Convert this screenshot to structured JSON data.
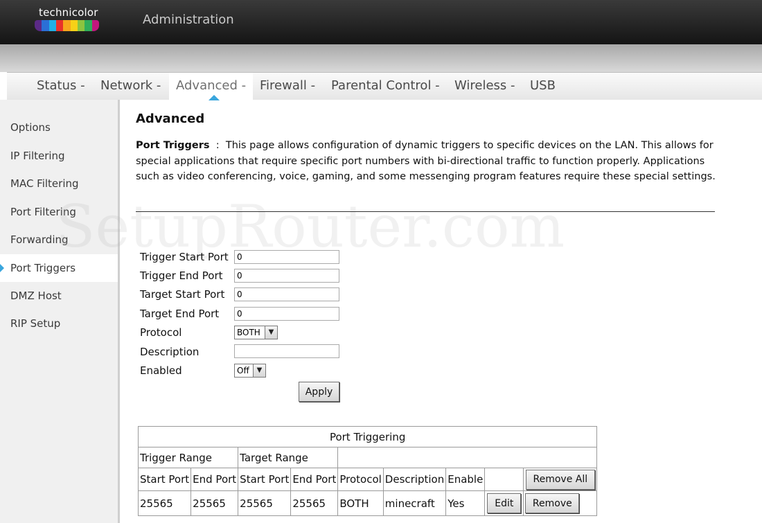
{
  "header": {
    "brand": "technicolor",
    "app_title": "Administration",
    "logo_colors": [
      "#5b2a86",
      "#2b6fd6",
      "#1fb0e6",
      "#e8312a",
      "#f7a51c",
      "#f7d117",
      "#8cc43f",
      "#2fae5b",
      "#c2177d"
    ]
  },
  "nav": {
    "items": [
      {
        "label": "Status -"
      },
      {
        "label": "Network -"
      },
      {
        "label": "Advanced -"
      },
      {
        "label": "Firewall -"
      },
      {
        "label": "Parental Control -"
      },
      {
        "label": "Wireless -"
      },
      {
        "label": "USB"
      }
    ],
    "active": "Advanced -"
  },
  "sidebar": {
    "items": [
      {
        "label": "Options"
      },
      {
        "label": "IP Filtering"
      },
      {
        "label": "MAC Filtering"
      },
      {
        "label": "Port Filtering"
      },
      {
        "label": "Forwarding"
      },
      {
        "label": "Port Triggers"
      },
      {
        "label": "DMZ Host"
      },
      {
        "label": "RIP Setup"
      }
    ],
    "active": "Port Triggers"
  },
  "watermark": "SetupRouter.com",
  "main": {
    "title": "Advanced",
    "desc_heading": "Port Triggers",
    "desc_sep": ":",
    "desc_text": "This page allows configuration of dynamic triggers to specific devices on the LAN. This allows for special applications that require specific port numbers with bi-directional traffic to function properly. Applications such as video conferencing, voice, gaming, and some messenging program features require these special settings."
  },
  "form": {
    "trigger_start_label": "Trigger Start Port",
    "trigger_start_value": "0",
    "trigger_end_label": "Trigger End Port",
    "trigger_end_value": "0",
    "target_start_label": "Target Start Port",
    "target_start_value": "0",
    "target_end_label": "Target End Port",
    "target_end_value": "0",
    "protocol_label": "Protocol",
    "protocol_value": "BOTH",
    "description_label": "Description",
    "description_value": "",
    "enabled_label": "Enabled",
    "enabled_value": "Off",
    "apply_label": "Apply"
  },
  "table": {
    "title": "Port Triggering",
    "group_trigger": "Trigger Range",
    "group_target": "Target Range",
    "columns": [
      "Start Port",
      "End Port",
      "Start Port",
      "End Port",
      "Protocol",
      "Description",
      "Enable"
    ],
    "remove_all_label": "Remove All",
    "rows": [
      {
        "trigger_start": "25565",
        "trigger_end": "25565",
        "target_start": "25565",
        "target_end": "25565",
        "protocol": "BOTH",
        "description": "minecraft",
        "enable": "Yes",
        "edit_label": "Edit",
        "remove_label": "Remove"
      }
    ]
  }
}
